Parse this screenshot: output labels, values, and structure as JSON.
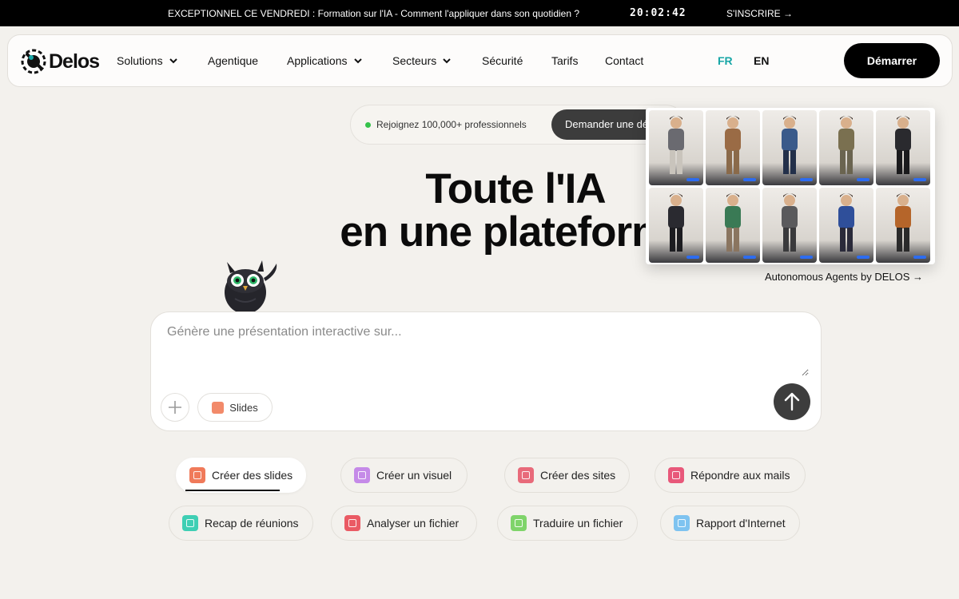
{
  "banner": {
    "message": "EXCEPTIONNEL CE VENDREDI : Formation sur l'IA - Comment l'appliquer dans son quotidien ?",
    "timer": "20:02:42",
    "cta": "S'INSCRIRE →"
  },
  "nav": {
    "logo": "Delos",
    "items": [
      {
        "label": "Solutions",
        "has_dropdown": true
      },
      {
        "label": "Agentique",
        "has_dropdown": false
      },
      {
        "label": "Applications",
        "has_dropdown": true
      },
      {
        "label": "Secteurs",
        "has_dropdown": true
      },
      {
        "label": "Sécurité",
        "has_dropdown": false
      },
      {
        "label": "Tarifs",
        "has_dropdown": false
      },
      {
        "label": "Contact",
        "has_dropdown": false
      }
    ],
    "lang_fr": "FR",
    "lang_en": "EN",
    "start_button": "Démarrer"
  },
  "pill": {
    "join_text": "Rejoignez 100,000+ professionnels",
    "demo_button": "Demander une démo"
  },
  "headline": {
    "line1": "Toute l'IA",
    "line2": "en une plateforme"
  },
  "agents": {
    "link": "Autonomous Agents by DELOS →"
  },
  "prompt": {
    "placeholder": "Génère une présentation interactive sur...",
    "mode_chip": "Slides"
  },
  "actions": [
    {
      "label": "Créer des slides",
      "icon": "slides-icon",
      "color": "#f07a5a",
      "active": true
    },
    {
      "label": "Créer un visuel",
      "icon": "brush-icon",
      "color": "#c58ae8",
      "active": false
    },
    {
      "label": "Créer des sites",
      "icon": "code-icon",
      "color": "#e86a7a",
      "active": false
    },
    {
      "label": "Répondre aux mails",
      "icon": "mail-icon",
      "color": "#e8587a",
      "active": false
    },
    {
      "label": "Recap de réunions",
      "icon": "video-icon",
      "color": "#3fcfb4",
      "active": false
    },
    {
      "label": "Analyser un fichier",
      "icon": "file-icon",
      "color": "#ea5a64",
      "active": false
    },
    {
      "label": "Traduire un fichier",
      "icon": "translate-icon",
      "color": "#7fd46a",
      "active": false
    },
    {
      "label": "Rapport d'Internet",
      "icon": "search-icon",
      "color": "#7ec3f0",
      "active": false
    }
  ],
  "colors": {
    "background": "#f3f1ed",
    "accent_teal": "#17a6a6",
    "dark": "#000000"
  }
}
